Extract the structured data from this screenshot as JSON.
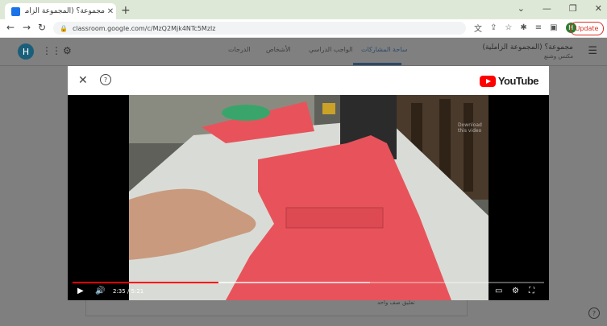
{
  "browser": {
    "tab_title": "مجموعة؟ (المجموعة الزاملية) | مناقـ",
    "url": "classroom.google.com/c/MzQ2Mjk4NTc5Mzlz",
    "profile_initial": "H",
    "update_label": "Update"
  },
  "classroom": {
    "avatar_initial": "H",
    "tabs": [
      "ساحة المشاركات",
      "الواجب الدراسي",
      "الأشخاص",
      "الدرجات"
    ],
    "active_tab": "ساحة المشاركات",
    "class_title": "مجموعة؟ (المجموعة الزاملية)",
    "class_subtitle": "مكنس وشنع",
    "comment_placeholder": "تعليق صف واحد"
  },
  "video_modal": {
    "brand": "YouTube",
    "current_time": "2:35 / 5:21",
    "progress_fraction": 0.31,
    "buffered_fraction": 0.63,
    "watermark": "Download this video"
  },
  "colors": {
    "accent": "#2d4a6b",
    "youtube_red": "#ff0000",
    "update_red": "#d93025",
    "fabric": "#e8535b"
  }
}
